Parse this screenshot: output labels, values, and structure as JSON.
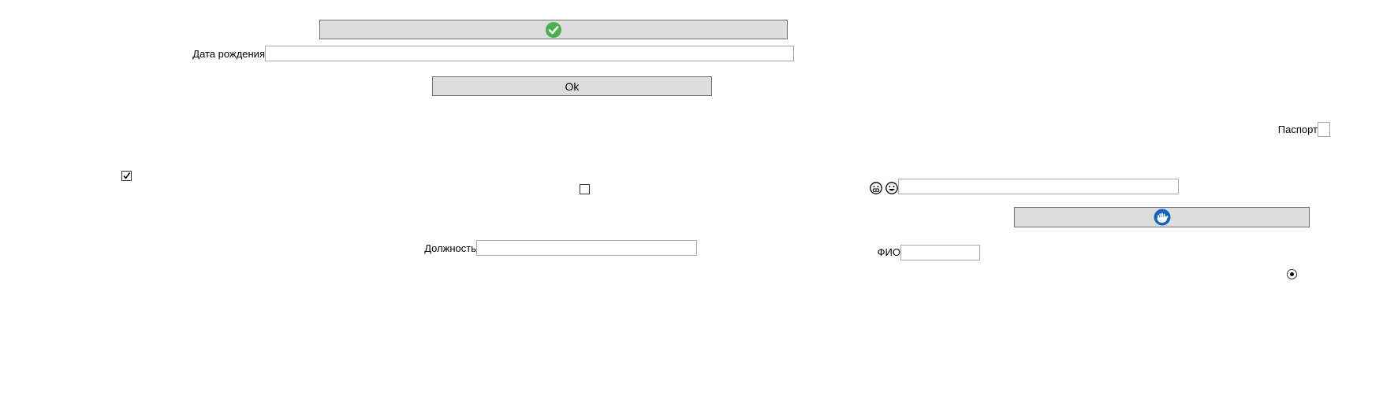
{
  "top_check_button": {
    "icon": "green-check-circle-icon",
    "accent": "#4caf50"
  },
  "birth_date": {
    "label": "Дата рождения",
    "value": ""
  },
  "ok_button": {
    "label": "Ok"
  },
  "passport": {
    "label": "Паспорт",
    "checked": false
  },
  "left_checkbox": {
    "checked": true
  },
  "middle_checkbox": {
    "checked": false
  },
  "emoji_field": {
    "icons": [
      "grimace-emoji-icon",
      "grin-emoji-icon"
    ],
    "value": ""
  },
  "blue_icon_button": {
    "icon": "blue-hand-circle-icon",
    "accent": "#1565c0"
  },
  "position": {
    "label": "Должность",
    "value": ""
  },
  "fio": {
    "label": "ФИО",
    "value": ""
  },
  "radio": {
    "selected": true
  }
}
